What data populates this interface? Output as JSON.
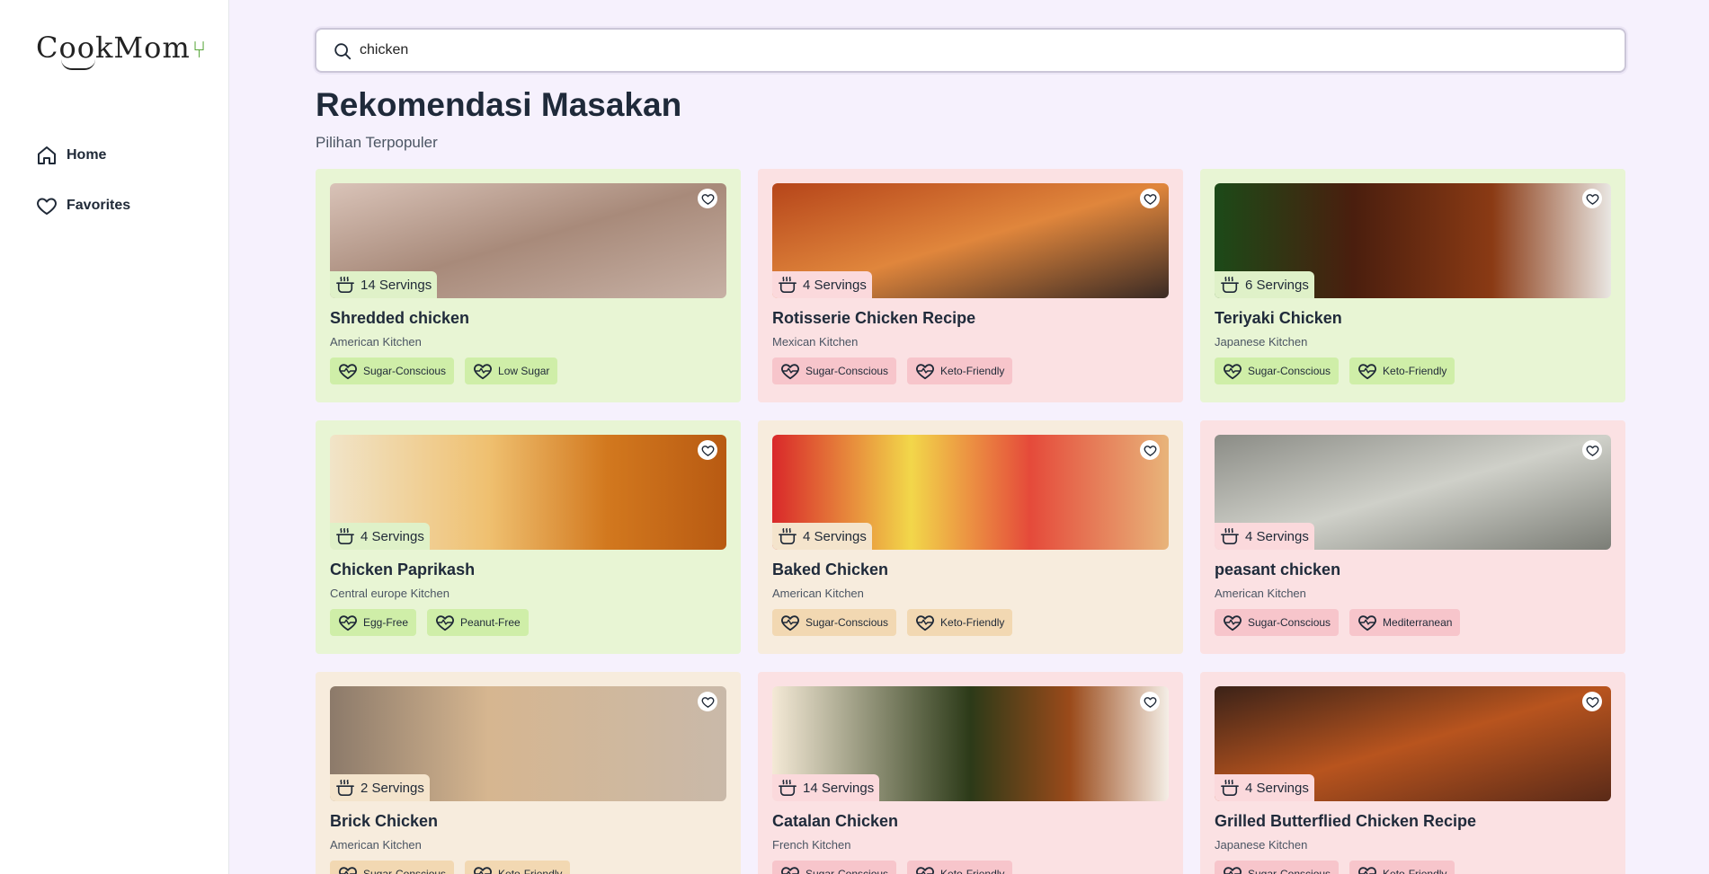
{
  "brand": {
    "logo_text": "CookMom"
  },
  "nav": [
    {
      "label": "Home",
      "icon": "home-icon"
    },
    {
      "label": "Favorites",
      "icon": "heart-icon"
    }
  ],
  "search": {
    "value": "chicken",
    "placeholder": ""
  },
  "page": {
    "title": "Rekomendasi Masakan",
    "subtitle": "Pilihan Terpopuler"
  },
  "colors": {
    "green_card": "#e8f5d4",
    "pink_card": "#fbe1e3",
    "beige_card": "#f7ecdd",
    "page_bg": "#f6f1fd"
  },
  "recipes": [
    {
      "title": "Shredded chicken",
      "servings": "14 Servings",
      "kitchen": "American Kitchen",
      "tags": [
        "Sugar-Conscious",
        "Low Sugar"
      ],
      "theme": "green"
    },
    {
      "title": "Rotisserie Chicken Recipe",
      "servings": "4 Servings",
      "kitchen": "Mexican Kitchen",
      "tags": [
        "Sugar-Conscious",
        "Keto-Friendly"
      ],
      "theme": "pink"
    },
    {
      "title": "Teriyaki Chicken",
      "servings": "6 Servings",
      "kitchen": "Japanese Kitchen",
      "tags": [
        "Sugar-Conscious",
        "Keto-Friendly"
      ],
      "theme": "green"
    },
    {
      "title": "Chicken Paprikash",
      "servings": "4 Servings",
      "kitchen": "Central europe Kitchen",
      "tags": [
        "Egg-Free",
        "Peanut-Free"
      ],
      "theme": "green"
    },
    {
      "title": "Baked Chicken",
      "servings": "4 Servings",
      "kitchen": "American Kitchen",
      "tags": [
        "Sugar-Conscious",
        "Keto-Friendly"
      ],
      "theme": "beige"
    },
    {
      "title": "peasant chicken",
      "servings": "4 Servings",
      "kitchen": "American Kitchen",
      "tags": [
        "Sugar-Conscious",
        "Mediterranean"
      ],
      "theme": "pink"
    },
    {
      "title": "Brick Chicken",
      "servings": "2 Servings",
      "kitchen": "American Kitchen",
      "tags": [
        "Sugar-Conscious",
        "Keto-Friendly"
      ],
      "theme": "beige"
    },
    {
      "title": "Catalan Chicken",
      "servings": "14 Servings",
      "kitchen": "French Kitchen",
      "tags": [
        "Sugar-Conscious",
        "Keto-Friendly"
      ],
      "theme": "pink"
    },
    {
      "title": "Grilled Butterflied Chicken Recipe",
      "servings": "4 Servings",
      "kitchen": "Japanese Kitchen",
      "tags": [
        "Sugar-Conscious",
        "Keto-Friendly"
      ],
      "theme": "pink"
    }
  ]
}
